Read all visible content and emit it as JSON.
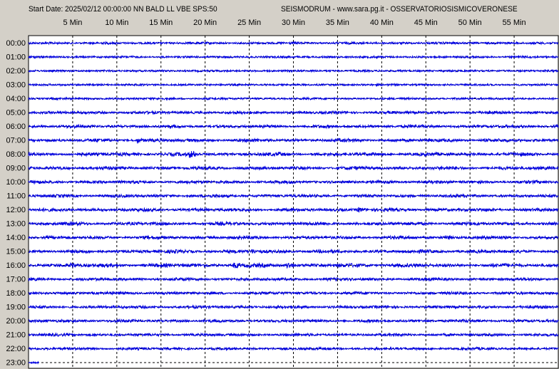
{
  "header": {
    "left": "Start Date: 2025/02/12 00:00:00 NN BALD LL VBE SPS:50",
    "right": "SEISMODRUM - www.sara.pg.it - OSSERVATORIOSISMICOVERONESE"
  },
  "colors": {
    "background": "#d4d0c8",
    "plot_background": "#ffffff",
    "trace": "#0000e0",
    "grid": "#000000"
  },
  "chart_data": {
    "type": "line",
    "title": "",
    "xlabel": "",
    "ylabel": "",
    "x_unit": "Min",
    "xlim": [
      0,
      60
    ],
    "x_ticks": [
      5,
      10,
      15,
      20,
      25,
      30,
      35,
      40,
      45,
      50,
      55
    ],
    "x_tick_labels": [
      "5 Min",
      "10 Min",
      "15 Min",
      "20 Min",
      "25 Min",
      "30 Min",
      "35 Min",
      "40 Min",
      "45 Min",
      "50 Min",
      "55 Min"
    ],
    "grid": true,
    "hours": [
      "00:00",
      "01:00",
      "02:00",
      "03:00",
      "04:00",
      "05:00",
      "06:00",
      "07:00",
      "08:00",
      "09:00",
      "10:00",
      "11:00",
      "12:00",
      "13:00",
      "14:00",
      "15:00",
      "16:00",
      "17:00",
      "18:00",
      "19:00",
      "20:00",
      "21:00",
      "22:00",
      "23:00"
    ],
    "trace_end_min": [
      60,
      60,
      60,
      60,
      60,
      60,
      60,
      60,
      60,
      60,
      60,
      60,
      60,
      60,
      60,
      60,
      60,
      60,
      60,
      60,
      60,
      60,
      60,
      1.2
    ],
    "relative_amplitude": [
      0.7,
      0.5,
      0.4,
      0.4,
      0.5,
      1.2,
      1.4,
      1.6,
      1.7,
      1.6,
      1.4,
      1.4,
      1.5,
      1.6,
      1.6,
      1.7,
      2.0,
      1.3,
      1.2,
      1.2,
      1.2,
      1.1,
      1.0,
      0.8
    ],
    "events": [
      {
        "hour": "07:00",
        "minute": 12.5,
        "amplitude": 2.5
      },
      {
        "hour": "08:00",
        "minute": 18.5,
        "amplitude": 4.5
      },
      {
        "hour": "08:00",
        "minute": 28.5,
        "amplitude": 2.5
      },
      {
        "hour": "12:00",
        "minute": 37.5,
        "amplitude": 3.0
      },
      {
        "hour": "14:00",
        "minute": 47.5,
        "amplitude": 2.5
      },
      {
        "hour": "15:00",
        "minute": 25.5,
        "amplitude": 2.5
      },
      {
        "hour": "16:00",
        "minute": 5.0,
        "amplitude": 3.0
      },
      {
        "hour": "16:00",
        "minute": 23.5,
        "amplitude": 3.0
      },
      {
        "hour": "16:00",
        "minute": 29.5,
        "amplitude": 3.5
      }
    ]
  }
}
